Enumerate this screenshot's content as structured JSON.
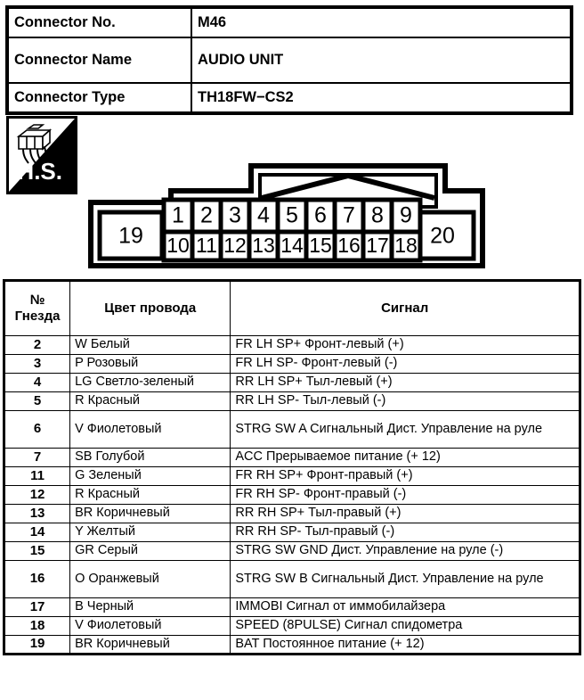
{
  "info": {
    "rows": [
      {
        "label": "Connector No.",
        "value": "M46"
      },
      {
        "label": "Connector Name",
        "value": "AUDIO UNIT"
      },
      {
        "label": "Connector Type",
        "value": "TH18FW−CS2"
      }
    ]
  },
  "badge": {
    "text": "H.S.",
    "icon": "connector-harness-icon"
  },
  "connector_diagram": {
    "top_row_pins": [
      "1",
      "2",
      "3",
      "4",
      "5",
      "6",
      "7",
      "8",
      "9"
    ],
    "bottom_row_pins": [
      "10",
      "11",
      "12",
      "13",
      "14",
      "15",
      "16",
      "17",
      "18"
    ],
    "left_pin": "19",
    "right_pin": "20"
  },
  "pin_table": {
    "headers": {
      "no_line1": "№",
      "no_line2": "Гнезда",
      "color": "Цвет провода",
      "signal": "Сигнал"
    },
    "rows": [
      {
        "no": "2",
        "color": "W Белый",
        "signal": "FR LH SP+ Фронт-левый (+)",
        "tall": false
      },
      {
        "no": "3",
        "color": "P Розовый",
        "signal": "FR LH SP- Фронт-левый (-)",
        "tall": false
      },
      {
        "no": "4",
        "color": "LG Светло-зеленый",
        "signal": "RR LH SP+ Тыл-левый (+)",
        "tall": false
      },
      {
        "no": "5",
        "color": "R Красный",
        "signal": "RR LH SP- Тыл-левый (-)",
        "tall": false
      },
      {
        "no": "6",
        "color": "V Фиолетовый",
        "signal": "STRG SW A Сигнальный Дист. Управление на руле",
        "tall": true
      },
      {
        "no": "7",
        "color": "SB Голубой",
        "signal": "ACC Прерываемое питание (+ 12)",
        "tall": false
      },
      {
        "no": "11",
        "color": "G Зеленый",
        "signal": "FR RH SP+ Фронт-правый (+)",
        "tall": false
      },
      {
        "no": "12",
        "color": "R Красный",
        "signal": "FR RH SP- Фронт-правый (-)",
        "tall": false
      },
      {
        "no": "13",
        "color": "BR Коричневый",
        "signal": "RR RH SP+ Тыл-правый (+)",
        "tall": false
      },
      {
        "no": "14",
        "color": "Y Желтый",
        "signal": "RR RH SP- Тыл-правый (-)",
        "tall": false
      },
      {
        "no": "15",
        "color": "GR Серый",
        "signal": "STRG SW GND Дист. Управление на руле (-)",
        "tall": false
      },
      {
        "no": "16",
        "color": "O Оранжевый",
        "signal": "STRG SW B Сигнальный Дист. Управление на руле",
        "tall": true
      },
      {
        "no": "17",
        "color": "B Черный",
        "signal": "IMMOBI Сигнал от иммобилайзера",
        "tall": false
      },
      {
        "no": "18",
        "color": "V Фиолетовый",
        "signal": "SPEED (8PULSE) Сигнал спидометра",
        "tall": false
      },
      {
        "no": "19",
        "color": "BR Коричневый",
        "signal": "BAT Постоянное питание (+ 12)",
        "tall": false
      }
    ]
  },
  "colors": {
    "line": "#000000",
    "background": "#ffffff"
  }
}
